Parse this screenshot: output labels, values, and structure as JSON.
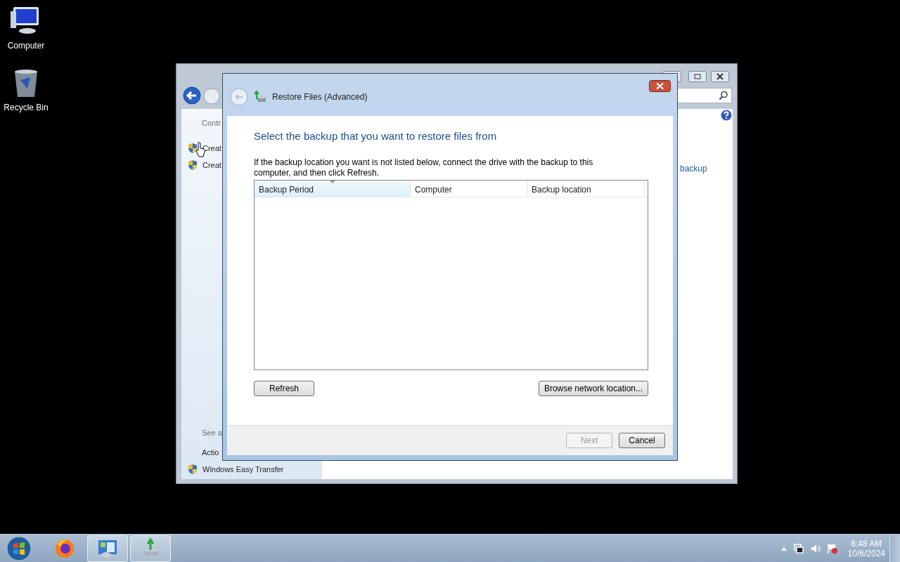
{
  "desktop_icons": [
    {
      "label": "Computer",
      "kind": "computer"
    },
    {
      "label": "Recycle Bin",
      "kind": "bin"
    }
  ],
  "back_window": {
    "sidebar": [
      {
        "text": "Contr",
        "kind": "heading"
      },
      {
        "text": "Creat",
        "kind": "shield-link"
      },
      {
        "text": "Creat",
        "kind": "shield-link"
      }
    ],
    "see_also": [
      {
        "text": "See a",
        "kind": "heading"
      },
      {
        "text": "Actio",
        "kind": "link"
      },
      {
        "text": "Windows Easy Transfer",
        "kind": "shield-link"
      }
    ],
    "content_link": "backup"
  },
  "dialog": {
    "title": "Restore Files (Advanced)",
    "heading": "Select the backup that you want to restore files from",
    "instruction": "If the backup location you want is not listed below, connect the drive with the backup to this computer, and then click Refresh.",
    "columns": [
      {
        "label": "Backup Period",
        "sorted": true
      },
      {
        "label": "Computer",
        "sorted": false
      },
      {
        "label": "Backup location",
        "sorted": false
      }
    ],
    "actions": [
      "Refresh",
      "Browse network location..."
    ],
    "footer_buttons": [
      {
        "label": "Next",
        "disabled": true
      },
      {
        "label": "Cancel",
        "disabled": false
      }
    ]
  },
  "taskbar": {
    "apps": [
      {
        "kind": "firefox",
        "open": false
      },
      {
        "kind": "control-panel",
        "open": true
      },
      {
        "kind": "backup",
        "open": true
      }
    ],
    "clock": {
      "time": "6:48 AM",
      "date": "10/6/2024"
    }
  }
}
